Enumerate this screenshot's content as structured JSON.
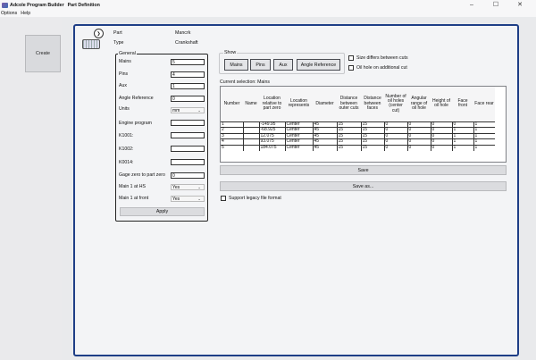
{
  "window": {
    "app_title": "Adcole Program Builder",
    "page_title": "Part Definition",
    "controls": {
      "minimize": "–",
      "maximize": "☐",
      "close": "✕"
    }
  },
  "menu": {
    "options": "Options",
    "help": "Help"
  },
  "left": {
    "create_label": "Create"
  },
  "part": {
    "part_label": "Part",
    "part_value": "Mancrk",
    "type_label": "Type",
    "type_value": "Crankshaft",
    "collapse_glyph": "❯"
  },
  "general": {
    "title": "General",
    "mains_label": "Mains",
    "mains_value": "5",
    "pins_label": "Pins",
    "pins_value": "4",
    "aux_label": "Aux",
    "aux_value": "1",
    "angle_ref_label": "Angle Reference",
    "angle_ref_value": "0",
    "units_label": "Units",
    "units_value": "mm",
    "engine_program_label": "Engine program",
    "engine_program_value": "",
    "k1001_label": "K1001:",
    "k1002_label": "K1002:",
    "k0014_label": "K0014:",
    "gage_zero_label": "Gage zero to part zero",
    "gage_zero_value": "0",
    "main1_hs_label": "Main 1 at HS",
    "main1_hs_value": "Yes",
    "main1_front_label": "Main 1 at front",
    "main1_front_value": "Yes",
    "apply_label": "Apply",
    "chevron": "⌄"
  },
  "show": {
    "title": "Show",
    "buttons": [
      "Mains",
      "Pins",
      "Aux",
      "Angle Reference"
    ],
    "size_differs_label": "Size differs between cuts",
    "oil_hole_label": "Oil hole on additional cut"
  },
  "current_selection": "Current selection: Mains",
  "table": {
    "headers": [
      "Number",
      "Name",
      "Location relative to part zero",
      "Location represents",
      "Diameter",
      "Distance between outer cuts",
      "Distance between faces",
      "Number of oil holes (center cut)",
      "Angular range of oil hole",
      "Height of oil hole",
      "Face front",
      "Face rear"
    ],
    "rows": [
      [
        "1",
        "",
        "-149.95",
        "Center",
        "45",
        "15",
        "15",
        "0",
        "0",
        "0",
        "0",
        "1"
      ],
      [
        "2",
        "",
        "-68.925",
        "Center",
        "45",
        "15",
        "15",
        "0",
        "0",
        "0",
        "1",
        "1"
      ],
      [
        "3",
        "",
        "12.075",
        "Center",
        "45",
        "15",
        "15",
        "0",
        "0",
        "0",
        "1",
        "1"
      ],
      [
        "4",
        "",
        "93.075",
        "Center",
        "45",
        "15",
        "15",
        "0",
        "0",
        "0",
        "1",
        "1"
      ],
      [
        "5",
        "",
        "184.075",
        "Center",
        "45",
        "15",
        "15",
        "0",
        "0",
        "0",
        "1",
        "1"
      ]
    ]
  },
  "actions": {
    "save_label": "Save",
    "save_as_label": "Save as...",
    "legacy_label": "Support legacy file format"
  }
}
